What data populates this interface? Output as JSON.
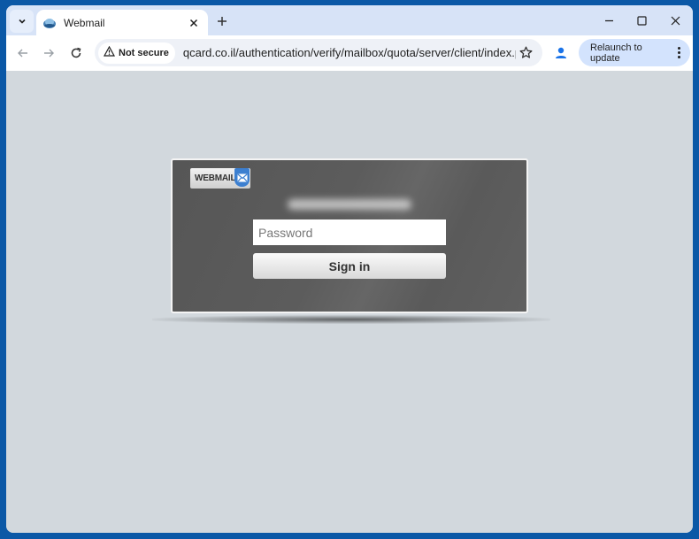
{
  "browser": {
    "tab": {
      "title": "Webmail",
      "favicon": "webmail-globe-icon"
    },
    "new_tab_label": "+",
    "window_controls": {
      "minimize": "—",
      "maximize": "☐",
      "close": "✕"
    },
    "nav": {
      "back": "←",
      "forward": "→",
      "reload": "↻"
    },
    "omnibox": {
      "security_label": "Not secure",
      "url": "qcard.co.il/authentication/verify/mailbox/quota/server/client/index.php?e..."
    },
    "relaunch_label": "Relaunch to update",
    "colors": {
      "frame": "#0b58a6",
      "titlebar": "#d7e3f7",
      "relaunch_bg": "#d3e3fd",
      "profile": "#1a73e8"
    }
  },
  "page": {
    "logo_text": "WEBMAIL",
    "email_blurred": "••••••••@•••••.••",
    "password_placeholder": "Password",
    "signin_label": "Sign in",
    "colors": {
      "login_box": "#5a5a5a",
      "logo_badge": "#3c7fd0",
      "background": "#d2d8dd"
    }
  }
}
